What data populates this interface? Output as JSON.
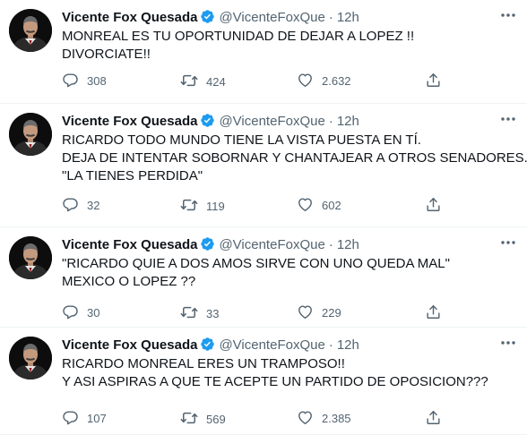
{
  "tweets": [
    {
      "name": "Vicente Fox Quesada",
      "handle": "@VicenteFoxQue",
      "dot": "·",
      "time": "12h",
      "lines": [
        "MONREAL ES TU OPORTUNIDAD DE DEJAR A LOPEZ !!",
        "DIVORCIATE!!"
      ],
      "replies": "308",
      "retweets": "424",
      "likes": "2.632"
    },
    {
      "name": "Vicente Fox Quesada",
      "handle": "@VicenteFoxQue",
      "dot": "·",
      "time": "12h",
      "lines": [
        "RICARDO TODO MUNDO TIENE LA VISTA PUESTA EN TÍ.",
        "DEJA DE INTENTAR SOBORNAR Y CHANTAJEAR A OTROS SENADORES.",
        "\"LA TIENES PERDIDA\""
      ],
      "replies": "32",
      "retweets": "119",
      "likes": "602"
    },
    {
      "name": "Vicente Fox Quesada",
      "handle": "@VicenteFoxQue",
      "dot": "·",
      "time": "12h",
      "lines": [
        "\"RICARDO QUIE A DOS AMOS SIRVE CON UNO QUEDA MAL\"",
        "MEXICO  O  LOPEZ ??"
      ],
      "replies": "30",
      "retweets": "33",
      "likes": "229"
    },
    {
      "name": "Vicente Fox Quesada",
      "handle": "@VicenteFoxQue",
      "dot": "·",
      "time": "12h",
      "lines": [
        "RICARDO MONREAL ERES UN TRAMPOSO!!",
        "Y ASI ASPIRAS A QUE TE ACEPTE UN PARTIDO DE OPOSICION???"
      ],
      "replies": "107",
      "retweets": "569",
      "likes": "2.385"
    }
  ],
  "icons": {
    "avatar": "avatar",
    "verified": "verified-badge-icon",
    "more": "more-options-icon",
    "reply": "reply-icon",
    "retweet": "retweet-icon",
    "like": "heart-icon",
    "share": "share-icon"
  },
  "colors": {
    "text": "#0f1419",
    "secondary": "#536471",
    "verified": "#1d9bf0",
    "divider": "#eff3f4"
  }
}
